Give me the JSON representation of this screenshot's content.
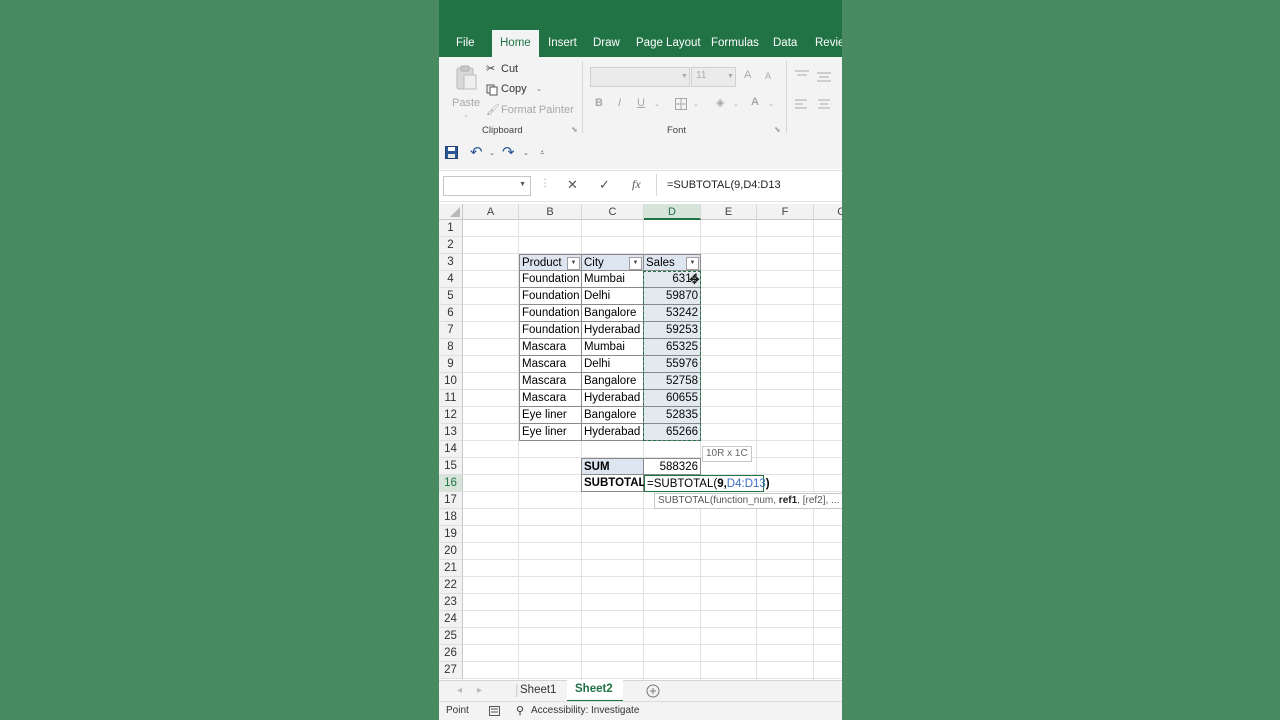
{
  "tabs": [
    "File",
    "Home",
    "Insert",
    "Draw",
    "Page Layout",
    "Formulas",
    "Data",
    "Review"
  ],
  "ribbon": {
    "clipboard": {
      "paste": "Paste",
      "cut": "Cut",
      "copy": "Copy",
      "format_painter": "Format Painter",
      "label": "Clipboard"
    },
    "font": {
      "size": "11",
      "bold": "B",
      "italic": "I",
      "underline": "U",
      "grow": "A",
      "shrink": "A",
      "font_color": "A",
      "label": "Font"
    }
  },
  "formula_bar": {
    "cancel": "✕",
    "enter": "✓",
    "fx": "fx",
    "value": "=SUBTOTAL(9,D4:D13"
  },
  "columns": [
    "A",
    "B",
    "C",
    "D",
    "E",
    "F",
    "G"
  ],
  "rows": [
    "1",
    "2",
    "3",
    "4",
    "5",
    "6",
    "7",
    "8",
    "9",
    "10",
    "11",
    "12",
    "13",
    "14",
    "15",
    "16",
    "17",
    "18",
    "19",
    "20",
    "21",
    "22",
    "23",
    "24",
    "25",
    "26",
    "27"
  ],
  "table": {
    "headers": [
      "Product",
      "City",
      "Sales"
    ],
    "rows": [
      [
        "Foundation",
        "Mumbai",
        "6314"
      ],
      [
        "Foundation",
        "Delhi",
        "59870"
      ],
      [
        "Foundation",
        "Bangalore",
        "53242"
      ],
      [
        "Foundation",
        "Hyderabad",
        "59253"
      ],
      [
        "Mascara",
        "Mumbai",
        "65325"
      ],
      [
        "Mascara",
        "Delhi",
        "55976"
      ],
      [
        "Mascara",
        "Bangalore",
        "52758"
      ],
      [
        "Mascara",
        "Hyderabad",
        "60655"
      ],
      [
        "Eye liner",
        "Bangalore",
        "52835"
      ],
      [
        "Eye liner",
        "Hyderabad",
        "65266"
      ]
    ]
  },
  "summary": {
    "sum_label": "SUM",
    "sum_value": "588326",
    "subtotal_label": "SUBTOTAL",
    "subtotal_formula_start": "=SUBTOTAL(",
    "subtotal_formula_arg1": "9,",
    "subtotal_formula_ref": "D4:D13",
    "subtotal_formula_end": ")"
  },
  "range_tooltip": "10R x 1C",
  "function_tooltip": {
    "pre": "SUBTOTAL(function_num, ",
    "bold": "ref1",
    "post": ", [ref2], ..."
  },
  "sheets": [
    "Sheet1",
    "Sheet2"
  ],
  "status": {
    "mode": "Point",
    "accessibility": "Accessibility: Investigate"
  },
  "colors": {
    "excel_green": "#217346",
    "background": "#4a8a63",
    "table_header": "#dde5f1"
  }
}
